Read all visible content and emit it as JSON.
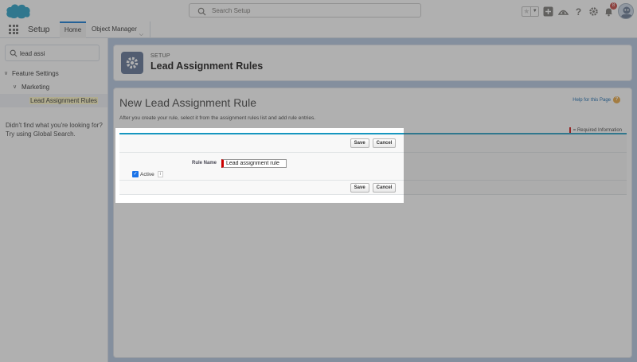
{
  "header": {
    "search_placeholder": "Search Setup",
    "notification_count": "8"
  },
  "appnav": {
    "app_name": "Setup",
    "tabs": [
      {
        "label": "Home"
      },
      {
        "label": "Object Manager"
      }
    ]
  },
  "sidebar": {
    "quick_find_value": "lead assi",
    "tree": [
      {
        "label": "Feature Settings"
      },
      {
        "label": "Marketing"
      },
      {
        "label": "Lead Assignment Rules",
        "highlight": "Lead Assi"
      }
    ],
    "not_found_line1": "Didn't find what you're looking for?",
    "not_found_line2": "Try using Global Search."
  },
  "page_header": {
    "eyebrow": "SETUP",
    "title": "Lead Assignment Rules"
  },
  "content": {
    "title": "New Lead Assignment Rule",
    "help_link": "Help for this Page",
    "description": "After you create your rule, select it from the assignment rules list and add rule entries.",
    "required_info": "= Required Information",
    "save_label": "Save",
    "cancel_label": "Cancel",
    "rule_name_label": "Rule Name",
    "rule_name_value": "Lead assignment rule",
    "active_label": "Active",
    "active_checked": true,
    "info_glyph": "i"
  },
  "colors": {
    "brand_blue": "#1797c0",
    "main_bg": "#b0c4df",
    "required_red": "#c00000",
    "badge_red": "#c23934"
  }
}
